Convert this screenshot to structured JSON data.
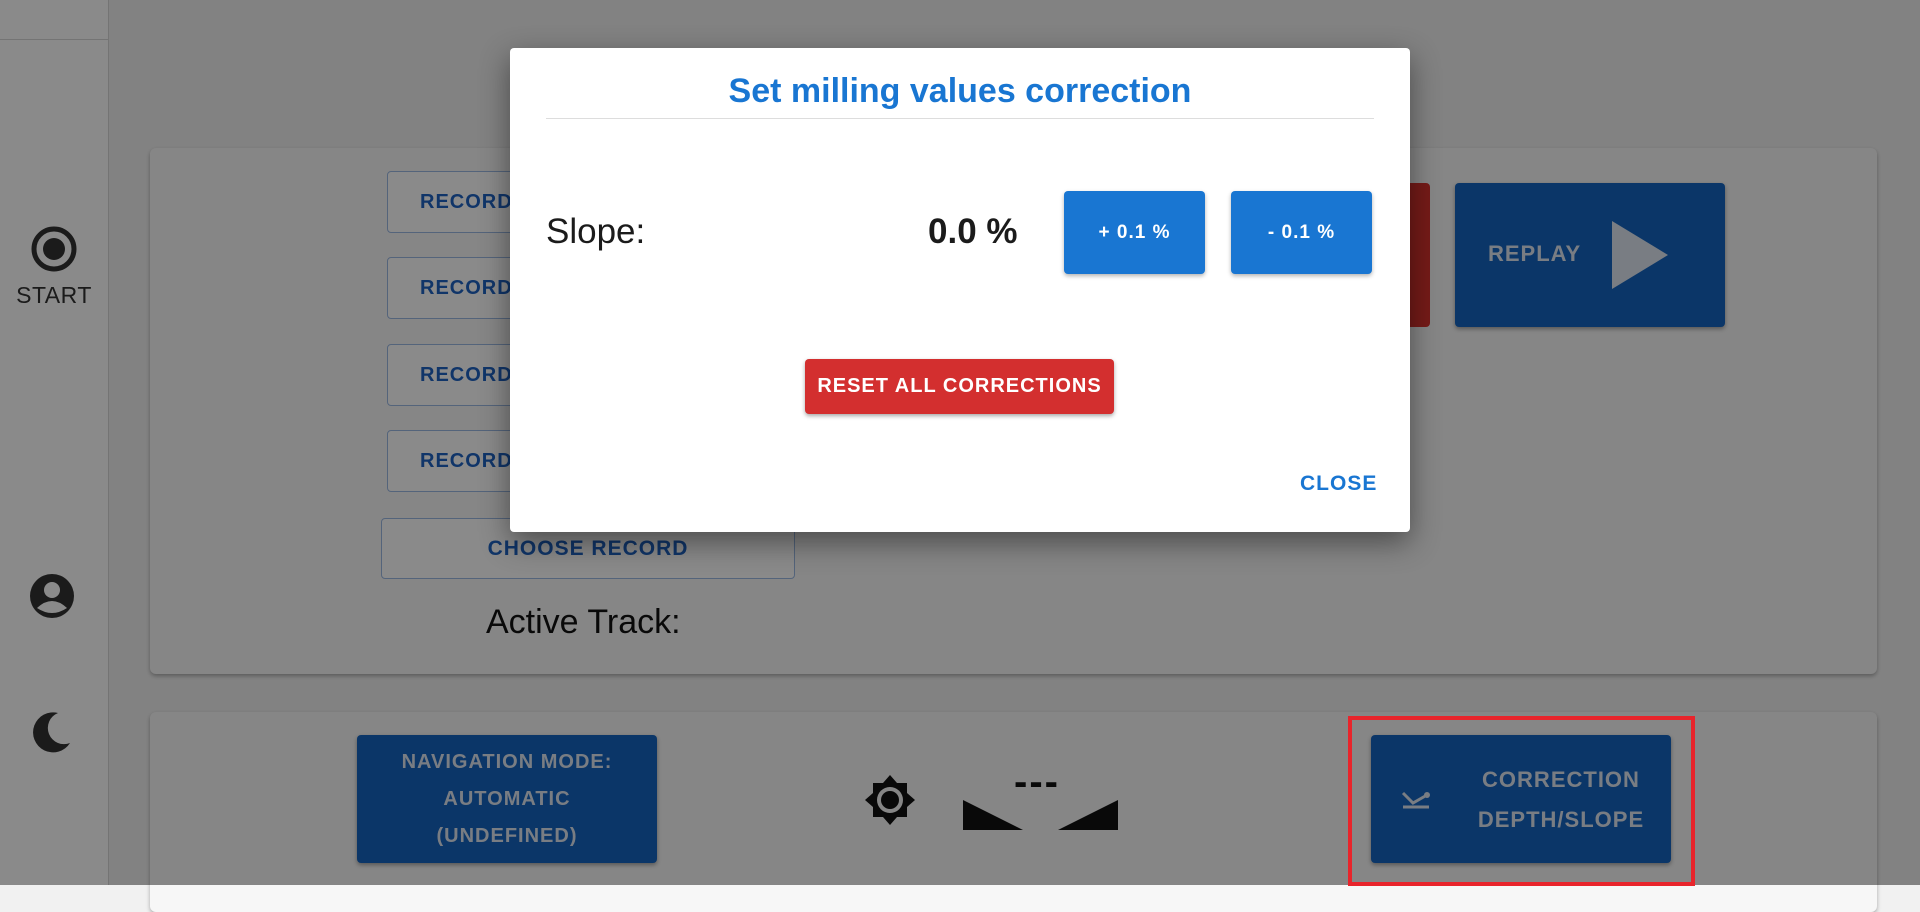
{
  "sidebar": {
    "start_label": "START",
    "icons": [
      "gear-icon",
      "record-icon",
      "account-icon",
      "moon-icon"
    ]
  },
  "main": {
    "record_buttons": [
      "RECORD",
      "RECORD",
      "RECORD",
      "RECORD"
    ],
    "choose_record_label": "CHOOSE RECORD",
    "active_track_label": "Active Track:",
    "replay_label": "REPLAY",
    "navigation_button": {
      "line1": "NAVIGATION MODE:",
      "line2": "AUTOMATIC",
      "line3": "(UNDEFINED)"
    },
    "slope_indicator": "---",
    "correction_button": {
      "line1": "CORRECTION",
      "line2": "DEPTH/SLOPE"
    }
  },
  "dialog": {
    "title": "Set milling values correction",
    "slope_label": "Slope:",
    "slope_value": "0.0 %",
    "plus_label": "+ 0.1 %",
    "minus_label": "- 0.1 %",
    "reset_label": "RESET ALL CORRECTIONS",
    "close_label": "CLOSE"
  },
  "colors": {
    "primary": "#1976d2",
    "danger": "#d32f2f",
    "highlight": "#e8242b"
  }
}
